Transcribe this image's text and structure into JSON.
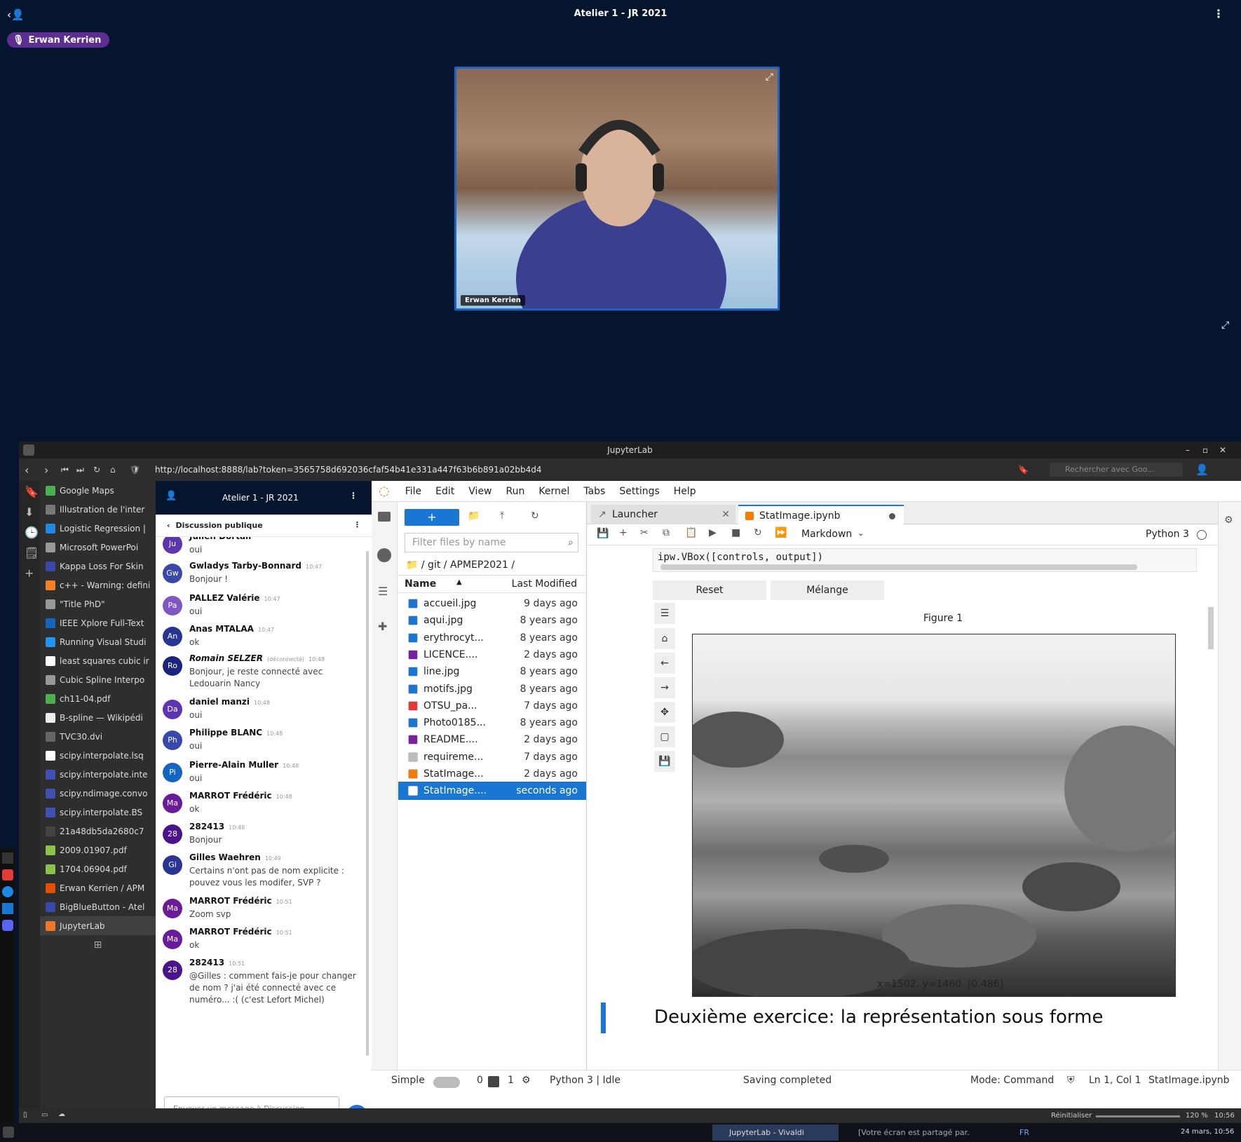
{
  "meeting": {
    "title": "Atelier 1 - JR 2021",
    "presenter": "Erwan Kerrien",
    "video_name": "Erwan Kerrien"
  },
  "window": {
    "title": "JupyterLab",
    "url": "http://localhost:8888/lab?token=3565758d692036cfaf54b41e331a447f63b6b891a02bb4d4",
    "search_placeholder": "Rechercher avec Goo..."
  },
  "panel": {
    "items": [
      {
        "label": "Google Maps",
        "color": "#4caf50"
      },
      {
        "label": "Illustration de l'inter",
        "color": "#777"
      },
      {
        "label": "Logistic Regression |",
        "color": "#1e88e5"
      },
      {
        "label": "Microsoft PowerPoi",
        "color": "#999"
      },
      {
        "label": "Kappa Loss For Skin",
        "color": "#3949ab"
      },
      {
        "label": "c++ - Warning: defini",
        "color": "#f48024"
      },
      {
        "label": "\"Title PhD\"",
        "color": "#999"
      },
      {
        "label": "IEEE Xplore Full-Text",
        "color": "#1565c0"
      },
      {
        "label": "Running Visual Studi",
        "color": "#2196f3"
      },
      {
        "label": "least squares cubic ir",
        "color": "#fff"
      },
      {
        "label": "Cubic Spline Interpo",
        "color": "#999"
      },
      {
        "label": "ch11-04.pdf",
        "color": "#4caf50"
      },
      {
        "label": "B-spline — Wikipédi",
        "color": "#eee"
      },
      {
        "label": "TVC30.dvi",
        "color": "#666"
      },
      {
        "label": "scipy.interpolate.lsq",
        "color": "#fff"
      },
      {
        "label": "scipy.interpolate.inte",
        "color": "#3f51b5"
      },
      {
        "label": "scipy.ndimage.convo",
        "color": "#3f51b5"
      },
      {
        "label": "scipy.interpolate.BS",
        "color": "#3f51b5"
      },
      {
        "label": "21a48db5da2680c7",
        "color": "#444"
      },
      {
        "label": "2009.01907.pdf",
        "color": "#8bc34a"
      },
      {
        "label": "1704.06904.pdf",
        "color": "#8bc34a"
      },
      {
        "label": "Erwan Kerrien / APM",
        "color": "#e65100"
      },
      {
        "label": "BigBlueButton - Atel",
        "color": "#3949ab"
      },
      {
        "label": "JupyterLab",
        "color": "#f37626"
      }
    ]
  },
  "chat": {
    "header": "Atelier 1 - JR 2021",
    "sub": "Discussion publique",
    "input_placeholder": "Envoyer un message à Discussion publique",
    "messages": [
      {
        "initials": "Ju",
        "name": "Julien Dortail",
        "time": "",
        "text": "oui",
        "color": "#5e35b1"
      },
      {
        "initials": "Gw",
        "name": "Gwladys Tarby-Bonnard",
        "time": "10:47",
        "text": "Bonjour !",
        "color": "#3949ab"
      },
      {
        "initials": "Pa",
        "name": "PALLEZ Valérie",
        "time": "10:47",
        "text": "oui",
        "color": "#7e57c2"
      },
      {
        "initials": "An",
        "name": "Anas MTALAA",
        "time": "10:47",
        "text": "ok",
        "color": "#283593"
      },
      {
        "initials": "Ro",
        "name": "Romain SELZER",
        "time": "10:48",
        "status": "(déconnecté)",
        "text": "Bonjour, je reste connecté avec Ledouarin Nancy",
        "color": "#1a237e"
      },
      {
        "initials": "Da",
        "name": "daniel manzi",
        "time": "10:48",
        "text": "oui",
        "color": "#5e35b1"
      },
      {
        "initials": "Ph",
        "name": "Philippe BLANC",
        "time": "10:48",
        "text": "oui",
        "color": "#3949ab"
      },
      {
        "initials": "Pi",
        "name": "Pierre-Alain Muller",
        "time": "10:48",
        "text": "oui",
        "color": "#1565c0"
      },
      {
        "initials": "Ma",
        "name": "MARROT Frédéric",
        "time": "10:48",
        "text": "ok",
        "color": "#6a1b9a"
      },
      {
        "initials": "28",
        "name": "282413",
        "time": "10:48",
        "text": "Bonjour",
        "color": "#4a148c"
      },
      {
        "initials": "Gi",
        "name": "Gilles Waehren",
        "time": "10:49",
        "text": "Certains n'ont pas de nom explicite : pouvez vous les modifer, SVP ?",
        "color": "#283593"
      },
      {
        "initials": "Ma",
        "name": "MARROT Frédéric",
        "time": "10:51",
        "text": "Zoom svp",
        "color": "#6a1b9a"
      },
      {
        "initials": "Ma",
        "name": "MARROT Frédéric",
        "time": "10:51",
        "text": "ok",
        "color": "#6a1b9a"
      },
      {
        "initials": "28",
        "name": "282413",
        "time": "10:51",
        "text": "@Gilles : comment fais-je pour changer de nom ? j'ai été connecté avec ce numéro... :( (c'est Lefort Michel)",
        "color": "#4a148c"
      }
    ]
  },
  "jupyter": {
    "menu": [
      "File",
      "Edit",
      "View",
      "Run",
      "Kernel",
      "Tabs",
      "Settings",
      "Help"
    ],
    "filter_placeholder": "Filter files by name",
    "path": "/ git / APMEP2021 /",
    "col_name": "Name",
    "col_modified": "Last Modified",
    "files": [
      {
        "name": "accueil.jpg",
        "modified": "9 days ago",
        "icon": "#1976d2"
      },
      {
        "name": "aqui.jpg",
        "modified": "8 years ago",
        "icon": "#1976d2"
      },
      {
        "name": "erythrocyt...",
        "modified": "8 years ago",
        "icon": "#1976d2"
      },
      {
        "name": "LICENCE....",
        "modified": "2 days ago",
        "icon": "#7b1fa2"
      },
      {
        "name": "line.jpg",
        "modified": "8 years ago",
        "icon": "#1976d2"
      },
      {
        "name": "motifs.jpg",
        "modified": "8 years ago",
        "icon": "#1976d2"
      },
      {
        "name": "OTSU_pa...",
        "modified": "7 days ago",
        "icon": "#e53935"
      },
      {
        "name": "Photo0185...",
        "modified": "8 years ago",
        "icon": "#1976d2"
      },
      {
        "name": "README....",
        "modified": "2 days ago",
        "icon": "#7b1fa2"
      },
      {
        "name": "requireme...",
        "modified": "7 days ago",
        "icon": "#bdbdbd"
      },
      {
        "name": "StatImage...",
        "modified": "2 days ago",
        "icon": "#f57c00"
      },
      {
        "name": "StatImage....",
        "modified": "seconds ago",
        "icon": "#ffffff"
      }
    ],
    "tabs": {
      "launcher": "Launcher",
      "notebook": "StatImage.ipynb"
    },
    "cell_type": "Markdown",
    "kernel": "Python 3",
    "code_line": "ipw.VBox([controls, output])",
    "btn_reset": "Reset",
    "btn_melange": "Mélange",
    "figure_title": "Figure 1",
    "coords": "x=1502. y=1460. [0.486]",
    "heading": "Deuxième exercice: la représentation sous forme",
    "status": {
      "mode_label": "Simple",
      "zero": "0",
      "one": "1",
      "kernel_status": "Python 3 | Idle",
      "saving": "Saving completed",
      "mode": "Mode: Command",
      "position": "Ln 1, Col 1",
      "file": "StatImage.ipynb"
    }
  },
  "vivaldi_status": {
    "reset": "Réinitialiser",
    "zoom": "120 %",
    "time": "10:56"
  },
  "taskbar": {
    "task1": "JupyterLab - Vivaldi",
    "task2": "[Votre écran est partagé par...",
    "lang": "FR",
    "datetime": "24 mars, 10:56"
  }
}
